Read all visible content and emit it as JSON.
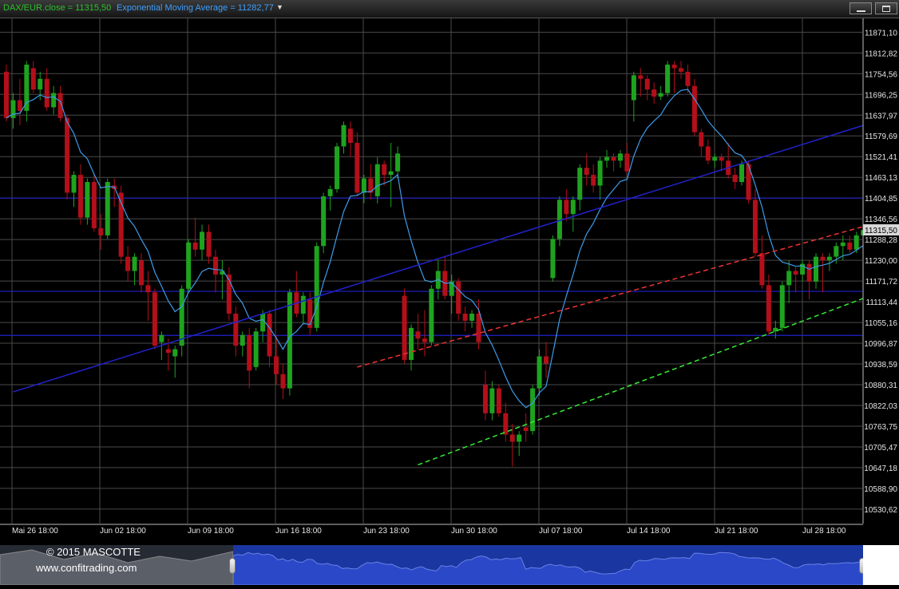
{
  "header": {
    "close_label": "DAX/EUR.close = 11315,50",
    "ema_label": "Exponential Moving Average = 11282,77",
    "dropdown_glyph": "▼",
    "minimize_icon": "minimize-icon",
    "maximize_icon": "maximize-icon"
  },
  "footer": {
    "copyright": "© 2015 MASCOTTE",
    "website": "www.confitrading.com"
  },
  "colors": {
    "background": "#000000",
    "grid": "#4a4a4a",
    "up_candle": "#1fa31f",
    "down_candle": "#b30f1a",
    "ema": "#3d9be9",
    "support_lines": "#2222cc",
    "red_dashed": "#ee3333",
    "green_dashed": "#33ee33",
    "price_tag_bg": "#d8d8d8"
  },
  "chart_data": {
    "type": "candlestick",
    "instrument": "DAX/EUR",
    "last_price_label": "11315,50",
    "ylim": [
      10490,
      11910
    ],
    "y_tick_labels": [
      "11871,10",
      "11812,82",
      "11754,56",
      "11696,25",
      "11637,97",
      "11579,69",
      "11521,41",
      "11463,13",
      "11404,85",
      "11346,56",
      "11288,28",
      "11230,00",
      "11171,72",
      "11113,44",
      "11055,16",
      "10996,87",
      "10938,59",
      "10880,31",
      "10822,03",
      "10763,75",
      "10705,47",
      "10647,18",
      "10588,90",
      "10530,62"
    ],
    "x_tick_labels": [
      "Mai 26 18:00",
      "Jun 02 18:00",
      "Jun 09 18:00",
      "Jun 16 18:00",
      "Jun 23 18:00",
      "Jun 30 18:00",
      "Jul 07 18:00",
      "Jul 14 18:00",
      "Jul 21 18:00",
      "Jul 28 18:00"
    ],
    "bar_interval": "4h",
    "candles": [
      [
        11760,
        11780,
        11620,
        11630
      ],
      [
        11630,
        11700,
        11600,
        11680
      ],
      [
        11680,
        11740,
        11610,
        11650
      ],
      [
        11650,
        11790,
        11620,
        11780
      ],
      [
        11770,
        11790,
        11700,
        11710
      ],
      [
        11710,
        11760,
        11680,
        11740
      ],
      [
        11740,
        11770,
        11650,
        11660
      ],
      [
        11660,
        11720,
        11640,
        11700
      ],
      [
        11700,
        11720,
        11620,
        11630
      ],
      [
        11630,
        11640,
        11400,
        11420
      ],
      [
        11420,
        11480,
        11380,
        11470
      ],
      [
        11470,
        11500,
        11330,
        11350
      ],
      [
        11350,
        11460,
        11330,
        11450
      ],
      [
        11450,
        11470,
        11310,
        11320
      ],
      [
        11320,
        11360,
        11260,
        11300
      ],
      [
        11300,
        11460,
        11290,
        11450
      ],
      [
        11440,
        11460,
        11380,
        11430
      ],
      [
        11420,
        11440,
        11220,
        11240
      ],
      [
        11240,
        11270,
        11170,
        11200
      ],
      [
        11200,
        11250,
        11160,
        11240
      ],
      [
        11230,
        11250,
        11140,
        11160
      ],
      [
        11160,
        11200,
        11060,
        11140
      ],
      [
        11140,
        11150,
        10980,
        10990
      ],
      [
        11000,
        11030,
        10950,
        11020
      ],
      [
        10980,
        11010,
        10920,
        10970
      ],
      [
        10960,
        10990,
        10900,
        10980
      ],
      [
        10990,
        11160,
        10960,
        11150
      ],
      [
        11150,
        11290,
        11140,
        11280
      ],
      [
        11280,
        11350,
        11240,
        11260
      ],
      [
        11260,
        11330,
        11230,
        11310
      ],
      [
        11310,
        11330,
        11220,
        11240
      ],
      [
        11240,
        11260,
        11140,
        11190
      ],
      [
        11190,
        11230,
        11120,
        11200
      ],
      [
        11190,
        11210,
        11060,
        11080
      ],
      [
        11080,
        11100,
        10960,
        10990
      ],
      [
        10990,
        11030,
        10960,
        11020
      ],
      [
        11020,
        11040,
        10870,
        10920
      ],
      [
        10930,
        11040,
        10920,
        11030
      ],
      [
        11030,
        11090,
        11000,
        11080
      ],
      [
        11080,
        11090,
        10930,
        10960
      ],
      [
        10960,
        11020,
        10880,
        10910
      ],
      [
        10910,
        10940,
        10840,
        10870
      ],
      [
        10870,
        11150,
        10850,
        11140
      ],
      [
        11140,
        11200,
        11070,
        11080
      ],
      [
        11080,
        11140,
        11050,
        11130
      ],
      [
        11120,
        11140,
        11020,
        11040
      ],
      [
        11040,
        11280,
        11030,
        11270
      ],
      [
        11270,
        11420,
        11250,
        11410
      ],
      [
        11410,
        11440,
        11370,
        11430
      ],
      [
        11430,
        11560,
        11420,
        11550
      ],
      [
        11550,
        11620,
        11530,
        11610
      ],
      [
        11600,
        11620,
        11520,
        11560
      ],
      [
        11560,
        11590,
        11410,
        11420
      ],
      [
        11420,
        11470,
        11390,
        11460
      ],
      [
        11460,
        11500,
        11400,
        11420
      ],
      [
        11410,
        11520,
        11390,
        11500
      ],
      [
        11500,
        11510,
        11440,
        11470
      ],
      [
        11470,
        11560,
        11380,
        11480
      ],
      [
        11480,
        11550,
        11460,
        11530
      ],
      [
        11130,
        11150,
        10940,
        10950
      ],
      [
        10950,
        11050,
        10920,
        11040
      ],
      [
        11030,
        11080,
        10980,
        11010
      ],
      [
        11010,
        11090,
        10960,
        11000
      ],
      [
        11000,
        11160,
        10990,
        11150
      ],
      [
        11150,
        11230,
        11120,
        11200
      ],
      [
        11200,
        11240,
        11120,
        11130
      ],
      [
        11130,
        11190,
        11080,
        11170
      ],
      [
        11170,
        11180,
        11060,
        11080
      ],
      [
        11080,
        11100,
        11030,
        11060
      ],
      [
        11060,
        11090,
        11040,
        11080
      ],
      [
        11080,
        11120,
        10980,
        11000
      ],
      [
        10880,
        10920,
        10780,
        10800
      ],
      [
        10800,
        10890,
        10780,
        10870
      ],
      [
        10870,
        10880,
        10790,
        10800
      ],
      [
        10800,
        10830,
        10720,
        10740
      ],
      [
        10740,
        10770,
        10650,
        10720
      ],
      [
        10720,
        10750,
        10680,
        10740
      ],
      [
        10760,
        10800,
        10720,
        10750
      ],
      [
        10750,
        10880,
        10740,
        10870
      ],
      [
        10870,
        10980,
        10850,
        10960
      ],
      [
        10960,
        11000,
        10900,
        10940
      ],
      [
        11180,
        11300,
        11170,
        11290
      ],
      [
        11290,
        11410,
        11270,
        11400
      ],
      [
        11400,
        11430,
        11340,
        11360
      ],
      [
        11360,
        11410,
        11310,
        11400
      ],
      [
        11400,
        11500,
        11370,
        11490
      ],
      [
        11490,
        11530,
        11440,
        11470
      ],
      [
        11470,
        11500,
        11420,
        11440
      ],
      [
        11440,
        11520,
        11400,
        11510
      ],
      [
        11510,
        11540,
        11490,
        11520
      ],
      [
        11520,
        11530,
        11480,
        11510
      ],
      [
        11510,
        11540,
        11490,
        11530
      ],
      [
        11530,
        11560,
        11470,
        11480
      ],
      [
        11680,
        11760,
        11620,
        11750
      ],
      [
        11750,
        11770,
        11690,
        11740
      ],
      [
        11740,
        11750,
        11680,
        11710
      ],
      [
        11710,
        11730,
        11670,
        11690
      ],
      [
        11690,
        11720,
        11680,
        11700
      ],
      [
        11700,
        11790,
        11690,
        11780
      ],
      [
        11780,
        11790,
        11700,
        11770
      ],
      [
        11770,
        11790,
        11740,
        11760
      ],
      [
        11760,
        11780,
        11700,
        11720
      ],
      [
        11720,
        11740,
        11580,
        11590
      ],
      [
        11590,
        11600,
        11520,
        11550
      ],
      [
        11550,
        11570,
        11500,
        11510
      ],
      [
        11510,
        11530,
        11490,
        11520
      ],
      [
        11520,
        11530,
        11480,
        11510
      ],
      [
        11510,
        11560,
        11460,
        11470
      ],
      [
        11470,
        11490,
        11430,
        11450
      ],
      [
        11450,
        11510,
        11440,
        11500
      ],
      [
        11500,
        11510,
        11390,
        11400
      ],
      [
        11400,
        11430,
        11240,
        11250
      ],
      [
        11250,
        11300,
        11150,
        11160
      ],
      [
        11160,
        11190,
        11020,
        11030
      ],
      [
        11030,
        11060,
        11010,
        11040
      ],
      [
        11040,
        11170,
        11030,
        11160
      ],
      [
        11160,
        11230,
        11110,
        11200
      ],
      [
        11200,
        11210,
        11140,
        11190
      ],
      [
        11190,
        11230,
        11170,
        11220
      ],
      [
        11220,
        11230,
        11120,
        11170
      ],
      [
        11170,
        11250,
        11150,
        11240
      ],
      [
        11240,
        11250,
        11140,
        11230
      ],
      [
        11230,
        11250,
        11200,
        11240
      ],
      [
        11240,
        11280,
        11220,
        11270
      ],
      [
        11270,
        11300,
        11230,
        11280
      ],
      [
        11280,
        11300,
        11250,
        11260
      ],
      [
        11260,
        11310,
        11250,
        11300
      ],
      [
        11300,
        11320,
        11280,
        11315
      ]
    ],
    "ema_label": "Exponential Moving Average",
    "horizontal_levels": [
      11404.85,
      11142.7,
      11018.8
    ],
    "trendlines": [
      {
        "style": "solid",
        "color": "blue",
        "from": [
          1,
          10860
        ],
        "to": [
          128,
          11615
        ]
      },
      {
        "style": "dashed",
        "color": "red",
        "from": [
          52,
          10930
        ],
        "to": [
          128,
          11330
        ]
      },
      {
        "style": "dashed",
        "color": "green",
        "from": [
          61,
          10655
        ],
        "to": [
          128,
          11130
        ]
      }
    ]
  }
}
